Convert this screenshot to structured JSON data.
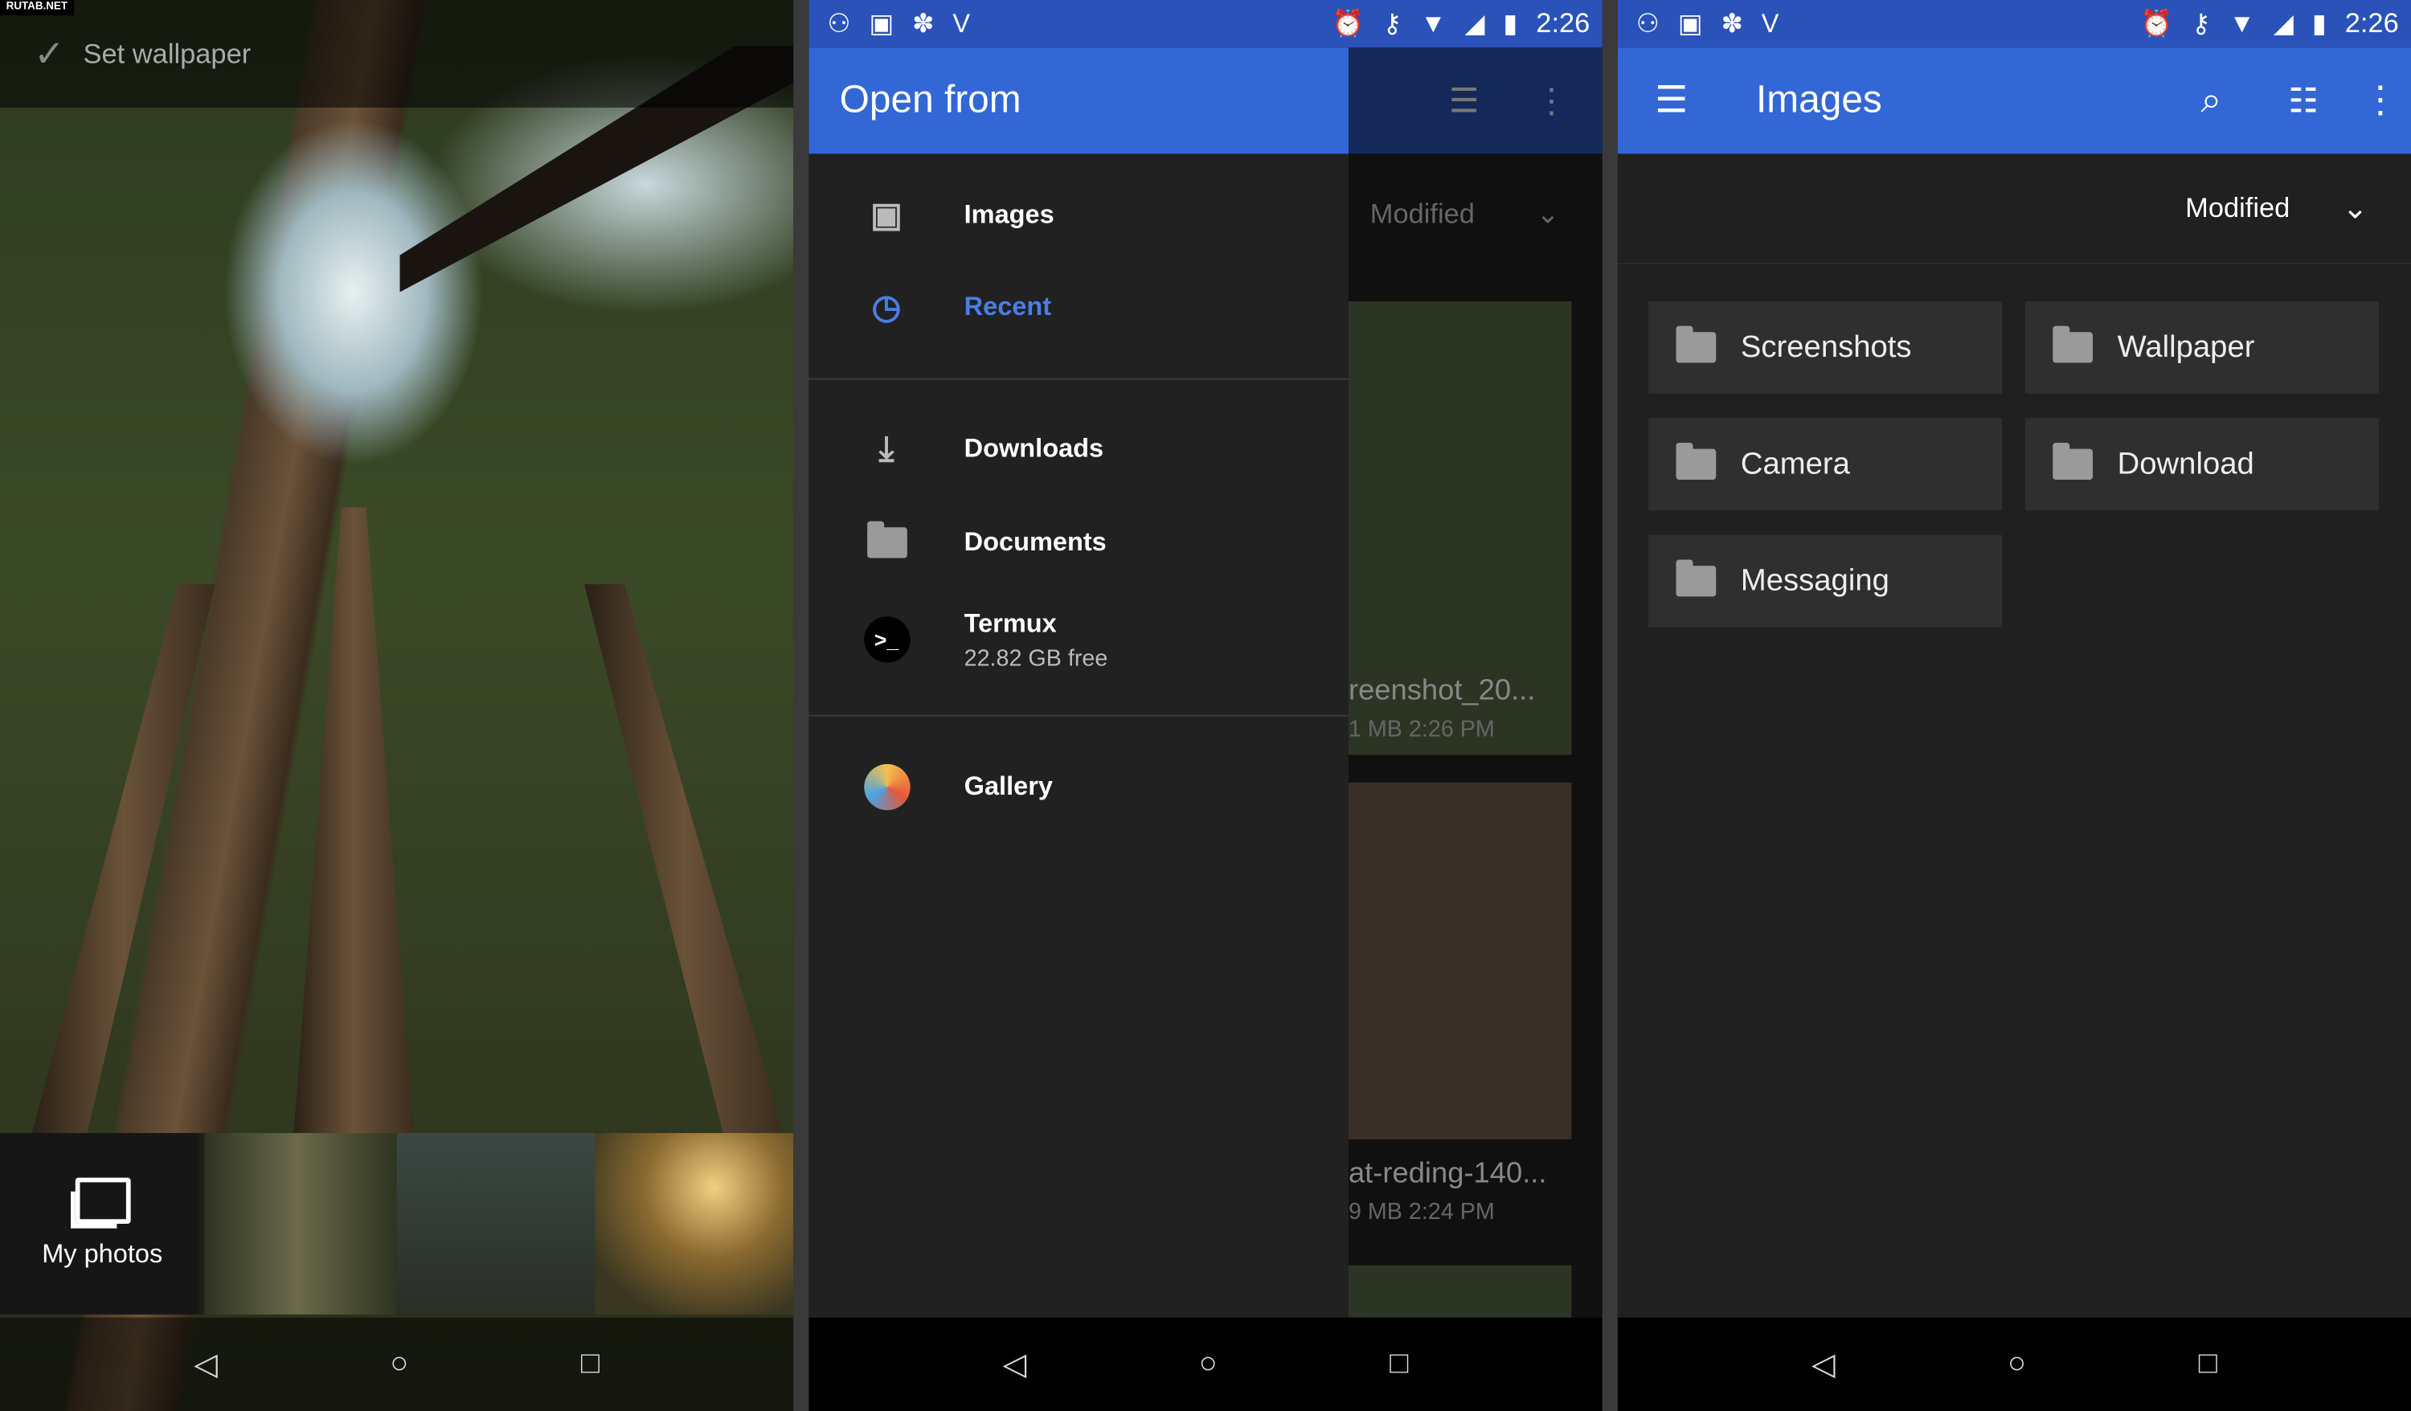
{
  "watermark": "RUTAB.NET",
  "status": {
    "time": "2:26"
  },
  "left": {
    "set_wallpaper": "Set wallpaper",
    "my_photos": "My photos"
  },
  "middle": {
    "drawer_title": "Open from",
    "items": [
      {
        "label": "Images",
        "icon": "image-icon"
      },
      {
        "label": "Recent",
        "icon": "clock-icon",
        "active": true
      },
      {
        "label": "Downloads",
        "icon": "download-icon"
      },
      {
        "label": "Documents",
        "icon": "folder-icon"
      },
      {
        "label": "Termux",
        "sub": "22.82 GB free",
        "icon": "terminal-icon"
      },
      {
        "label": "Gallery",
        "icon": "gallery-icon"
      }
    ],
    "behind": {
      "sort": "Modified",
      "files": [
        {
          "name": "reenshot_20...",
          "meta": "1 MB 2:26 PM"
        },
        {
          "name": "at-reding-140...",
          "meta": "9 MB 2:24 PM"
        }
      ]
    }
  },
  "right": {
    "title": "Images",
    "sort": "Modified",
    "folders": [
      "Screenshots",
      "Wallpaper",
      "Camera",
      "Download",
      "Messaging"
    ]
  },
  "colors": {
    "primary": "#3367d6",
    "accent_text": "#4a7de8",
    "background": "#202020"
  }
}
